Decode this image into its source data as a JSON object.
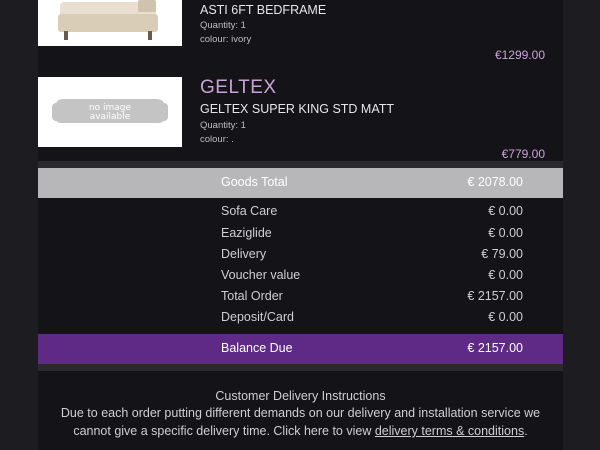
{
  "items": [
    {
      "brand": "",
      "name": "ASTI 6FT BEDFRAME",
      "quantity": "Quantity: 1",
      "colour": "colour: ivory",
      "price": "€1299.00"
    },
    {
      "brand": "GELTEX",
      "name": "GELTEX SUPER KING STD MATT",
      "quantity": "Quantity: 1",
      "colour": "colour: .",
      "price": "€779.00",
      "image_text": [
        "no image",
        "available"
      ]
    }
  ],
  "summary": {
    "goods_total_label": "Goods Total",
    "goods_total_value": "€ 2078.00",
    "lines": [
      {
        "label": "Sofa Care",
        "value": "€ 0.00"
      },
      {
        "label": "Eaziglide",
        "value": "€ 0.00"
      },
      {
        "label": "Delivery",
        "value": "€ 79.00"
      },
      {
        "label": "Voucher value",
        "value": "€ 0.00"
      },
      {
        "label": "Total Order",
        "value": "€ 2157.00"
      },
      {
        "label": "Deposit/Card",
        "value": "€ 0.00"
      }
    ],
    "balance_label": "Balance Due",
    "balance_value": "€ 2157.00"
  },
  "instructions": {
    "title": "Customer Delivery Instructions",
    "line1": "Due to each order putting different demands on our delivery and installation service we",
    "line2_prefix": "cannot give a specific delivery time. Click here to view ",
    "link": "delivery terms & conditions",
    "line2_suffix": "."
  },
  "colors": {
    "accent": "#c9a3d8",
    "balance_bg": "#5e2a86",
    "total_bg": "#b7b7b9"
  }
}
